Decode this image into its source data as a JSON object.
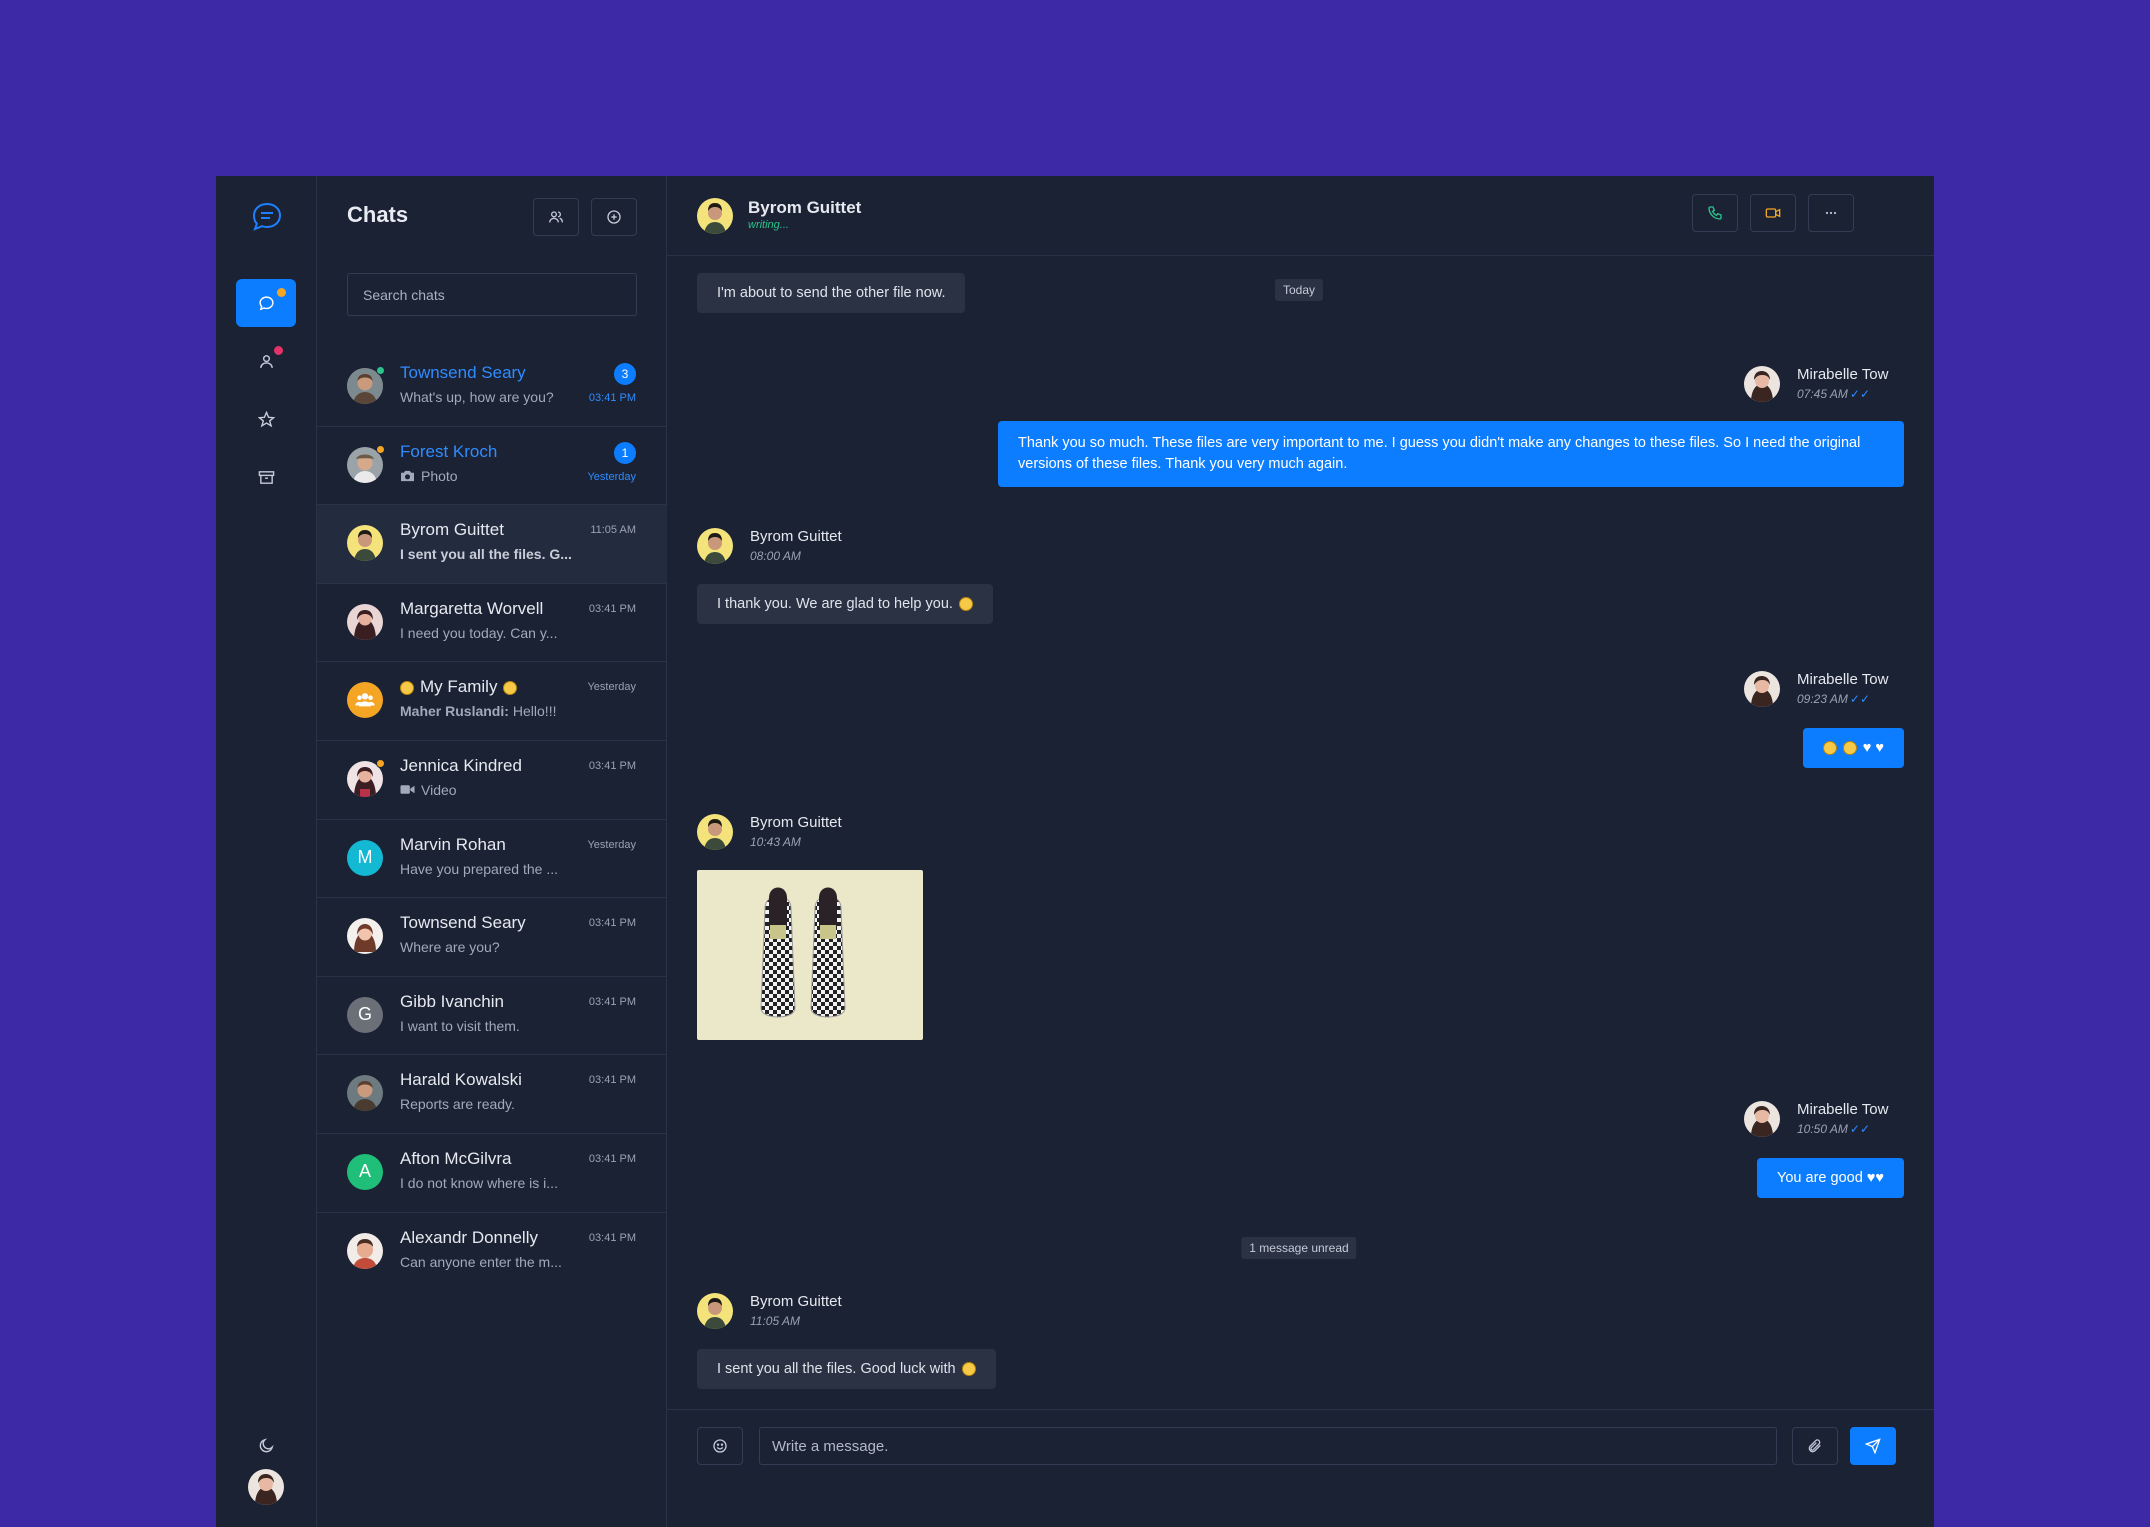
{
  "colors": {
    "background": "#3d28a5",
    "panel": "#1b2234",
    "accent": "#0d7dff",
    "online": "#2bc48a",
    "away": "#f5a524",
    "alert": "#e5336a"
  },
  "rail": {
    "logo_icon": "chat-bubble-icon",
    "items": [
      {
        "icon": "message-icon",
        "active": true
      },
      {
        "icon": "user-icon",
        "active": false
      },
      {
        "icon": "star-icon",
        "active": false
      },
      {
        "icon": "archive-icon",
        "active": false
      }
    ],
    "theme_icon": "moon-icon"
  },
  "list": {
    "title": "Chats",
    "search_placeholder": "Search chats",
    "chats": [
      {
        "name": "Townsend Seary",
        "preview": "What's up, how are you?",
        "time": "03:41 PM",
        "badge": "3"
      },
      {
        "name": "Forest Kroch",
        "preview": "Photo",
        "time": "Yesterday",
        "badge": "1"
      },
      {
        "name": "Byrom Guittet",
        "preview": "I sent you all the files. G...",
        "time": "11:05 AM"
      },
      {
        "name": "Margaretta Worvell",
        "preview": "I need you today. Can y...",
        "time": "03:41 PM"
      },
      {
        "name": "My Family",
        "sender": "Maher Ruslandi:",
        "preview": "Hello!!!",
        "time": "Yesterday"
      },
      {
        "name": "Jennica Kindred",
        "preview": "Video",
        "time": "03:41 PM"
      },
      {
        "name": "Marvin Rohan",
        "initial": "M",
        "preview": "Have you prepared the ...",
        "time": "Yesterday"
      },
      {
        "name": "Townsend Seary",
        "preview": "Where are you?",
        "time": "03:41 PM"
      },
      {
        "name": "Gibb Ivanchin",
        "initial": "G",
        "preview": "I want to visit them.",
        "time": "03:41 PM"
      },
      {
        "name": "Harald Kowalski",
        "preview": "Reports are ready.",
        "time": "03:41 PM"
      },
      {
        "name": "Afton McGilvra",
        "initial": "A",
        "preview": "I do not know where is i...",
        "time": "03:41 PM"
      },
      {
        "name": "Alexandr Donnelly",
        "preview": "Can anyone enter the m...",
        "time": "03:41 PM"
      }
    ]
  },
  "conversation": {
    "name": "Byrom Guittet",
    "status": "writing...",
    "separator_today": "Today",
    "separator_unread": "1 message unread",
    "messages": [
      {
        "text": "I'm about to send the other file now."
      },
      {
        "author": "Mirabelle Tow",
        "time": "07:45 AM",
        "text": "Thank you so much. These files are very important to me. I guess you didn't make any changes to these files. So I need the original versions of these files. Thank you very much again."
      },
      {
        "author": "Byrom Guittet",
        "time": "08:00 AM",
        "text": "I thank you. We are glad to help you."
      },
      {
        "author": "Mirabelle Tow",
        "time": "09:23 AM",
        "text": ""
      },
      {
        "author": "Byrom Guittet",
        "time": "10:43 AM",
        "image": "checkered-slip-on-shoes"
      },
      {
        "author": "Mirabelle Tow",
        "time": "10:50 AM",
        "text": "You are good"
      },
      {
        "author": "Byrom Guittet",
        "time": "11:05 AM",
        "text": "I sent you all the files. Good luck with"
      }
    ],
    "composer_placeholder": "Write a message."
  }
}
